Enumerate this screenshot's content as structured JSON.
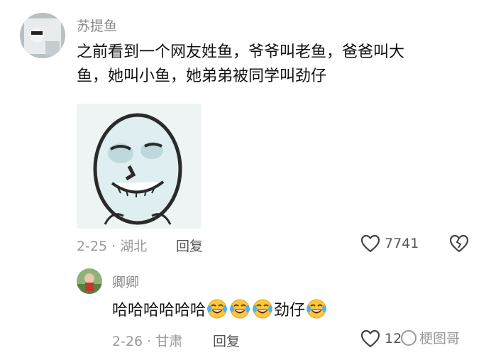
{
  "comment": {
    "username": "苏提鱼",
    "text_line1": "之前看到一个网友姓鱼，爷爷叫老鱼，爸爸叫大",
    "text_line2": "鱼，她叫小鱼，她弟弟被同学叫劲仔",
    "date_location": "2-25 · 湖北",
    "reply_label": "回复",
    "likes": "7741",
    "avatar_icon": "user-avatar",
    "sticker_icon": "meme-face-sticker"
  },
  "reply": {
    "username": "卿卿",
    "text_prefix": "哈哈哈哈哈哈",
    "text_suffix": "劲仔",
    "emoji_name": "laughing-crying-emoji",
    "date_location": "2-26 · 甘肃",
    "reply_label": "回复",
    "likes": "12",
    "avatar_icon": "user-avatar"
  },
  "watermark": {
    "text": "梗图哥"
  }
}
